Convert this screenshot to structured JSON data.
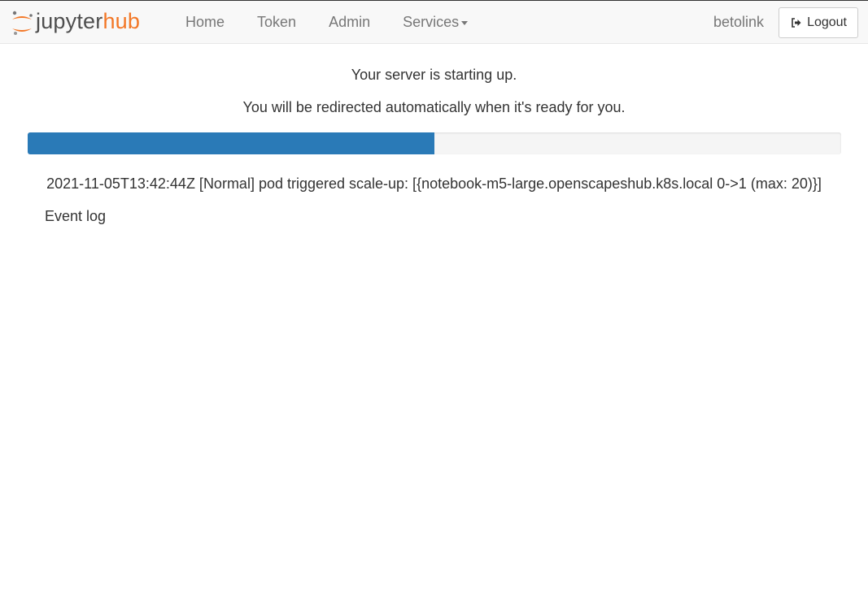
{
  "navbar": {
    "logo": {
      "text_main": "jupyter",
      "text_accent": "hub",
      "icon": "jupyter-logo-icon"
    },
    "links": [
      {
        "label": "Home"
      },
      {
        "label": "Token"
      },
      {
        "label": "Admin"
      },
      {
        "label": "Services",
        "has_dropdown": true
      }
    ],
    "username": "betolink",
    "logout_label": "Logout",
    "logout_icon": "sign-out-icon"
  },
  "main": {
    "status_message": "Your server is starting up.",
    "redirect_message": "You will be redirected automatically when it's ready for you.",
    "progress": {
      "fraction": 0.5,
      "color": "#2a7ab7",
      "track_color": "#f5f5f5"
    },
    "latest_event": "2021-11-05T13:42:44Z [Normal] pod triggered scale-up: [{notebook-m5-large.openscapeshub.k8s.local 0->1 (max: 20)}]",
    "event_log_label": "Event log"
  },
  "colors": {
    "accent": "#f37726",
    "navbar_bg": "#f8f8f8",
    "link": "#777777"
  }
}
